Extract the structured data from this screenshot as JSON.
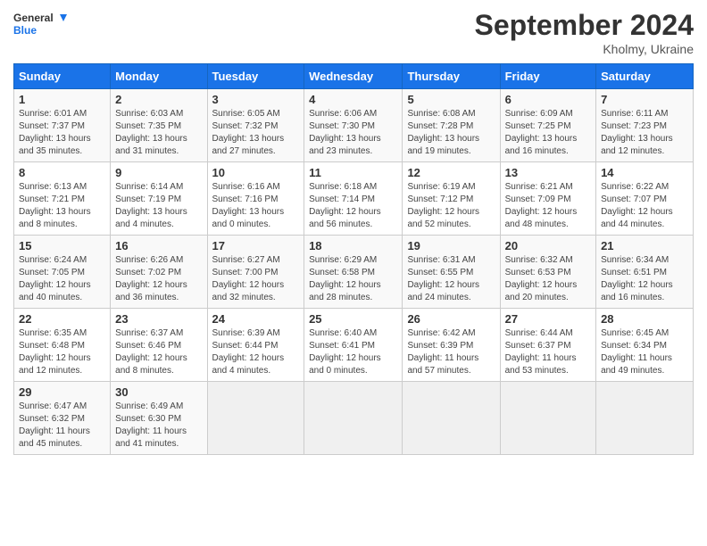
{
  "app": {
    "logo_line1": "General",
    "logo_line2": "Blue"
  },
  "header": {
    "month": "September 2024",
    "location": "Kholmy, Ukraine"
  },
  "days_of_week": [
    "Sunday",
    "Monday",
    "Tuesday",
    "Wednesday",
    "Thursday",
    "Friday",
    "Saturday"
  ],
  "weeks": [
    [
      {
        "day": "1",
        "info": "Sunrise: 6:01 AM\nSunset: 7:37 PM\nDaylight: 13 hours\nand 35 minutes."
      },
      {
        "day": "2",
        "info": "Sunrise: 6:03 AM\nSunset: 7:35 PM\nDaylight: 13 hours\nand 31 minutes."
      },
      {
        "day": "3",
        "info": "Sunrise: 6:05 AM\nSunset: 7:32 PM\nDaylight: 13 hours\nand 27 minutes."
      },
      {
        "day": "4",
        "info": "Sunrise: 6:06 AM\nSunset: 7:30 PM\nDaylight: 13 hours\nand 23 minutes."
      },
      {
        "day": "5",
        "info": "Sunrise: 6:08 AM\nSunset: 7:28 PM\nDaylight: 13 hours\nand 19 minutes."
      },
      {
        "day": "6",
        "info": "Sunrise: 6:09 AM\nSunset: 7:25 PM\nDaylight: 13 hours\nand 16 minutes."
      },
      {
        "day": "7",
        "info": "Sunrise: 6:11 AM\nSunset: 7:23 PM\nDaylight: 13 hours\nand 12 minutes."
      }
    ],
    [
      {
        "day": "8",
        "info": "Sunrise: 6:13 AM\nSunset: 7:21 PM\nDaylight: 13 hours\nand 8 minutes."
      },
      {
        "day": "9",
        "info": "Sunrise: 6:14 AM\nSunset: 7:19 PM\nDaylight: 13 hours\nand 4 minutes."
      },
      {
        "day": "10",
        "info": "Sunrise: 6:16 AM\nSunset: 7:16 PM\nDaylight: 13 hours\nand 0 minutes."
      },
      {
        "day": "11",
        "info": "Sunrise: 6:18 AM\nSunset: 7:14 PM\nDaylight: 12 hours\nand 56 minutes."
      },
      {
        "day": "12",
        "info": "Sunrise: 6:19 AM\nSunset: 7:12 PM\nDaylight: 12 hours\nand 52 minutes."
      },
      {
        "day": "13",
        "info": "Sunrise: 6:21 AM\nSunset: 7:09 PM\nDaylight: 12 hours\nand 48 minutes."
      },
      {
        "day": "14",
        "info": "Sunrise: 6:22 AM\nSunset: 7:07 PM\nDaylight: 12 hours\nand 44 minutes."
      }
    ],
    [
      {
        "day": "15",
        "info": "Sunrise: 6:24 AM\nSunset: 7:05 PM\nDaylight: 12 hours\nand 40 minutes."
      },
      {
        "day": "16",
        "info": "Sunrise: 6:26 AM\nSunset: 7:02 PM\nDaylight: 12 hours\nand 36 minutes."
      },
      {
        "day": "17",
        "info": "Sunrise: 6:27 AM\nSunset: 7:00 PM\nDaylight: 12 hours\nand 32 minutes."
      },
      {
        "day": "18",
        "info": "Sunrise: 6:29 AM\nSunset: 6:58 PM\nDaylight: 12 hours\nand 28 minutes."
      },
      {
        "day": "19",
        "info": "Sunrise: 6:31 AM\nSunset: 6:55 PM\nDaylight: 12 hours\nand 24 minutes."
      },
      {
        "day": "20",
        "info": "Sunrise: 6:32 AM\nSunset: 6:53 PM\nDaylight: 12 hours\nand 20 minutes."
      },
      {
        "day": "21",
        "info": "Sunrise: 6:34 AM\nSunset: 6:51 PM\nDaylight: 12 hours\nand 16 minutes."
      }
    ],
    [
      {
        "day": "22",
        "info": "Sunrise: 6:35 AM\nSunset: 6:48 PM\nDaylight: 12 hours\nand 12 minutes."
      },
      {
        "day": "23",
        "info": "Sunrise: 6:37 AM\nSunset: 6:46 PM\nDaylight: 12 hours\nand 8 minutes."
      },
      {
        "day": "24",
        "info": "Sunrise: 6:39 AM\nSunset: 6:44 PM\nDaylight: 12 hours\nand 4 minutes."
      },
      {
        "day": "25",
        "info": "Sunrise: 6:40 AM\nSunset: 6:41 PM\nDaylight: 12 hours\nand 0 minutes."
      },
      {
        "day": "26",
        "info": "Sunrise: 6:42 AM\nSunset: 6:39 PM\nDaylight: 11 hours\nand 57 minutes."
      },
      {
        "day": "27",
        "info": "Sunrise: 6:44 AM\nSunset: 6:37 PM\nDaylight: 11 hours\nand 53 minutes."
      },
      {
        "day": "28",
        "info": "Sunrise: 6:45 AM\nSunset: 6:34 PM\nDaylight: 11 hours\nand 49 minutes."
      }
    ],
    [
      {
        "day": "29",
        "info": "Sunrise: 6:47 AM\nSunset: 6:32 PM\nDaylight: 11 hours\nand 45 minutes."
      },
      {
        "day": "30",
        "info": "Sunrise: 6:49 AM\nSunset: 6:30 PM\nDaylight: 11 hours\nand 41 minutes."
      },
      {
        "day": "",
        "info": ""
      },
      {
        "day": "",
        "info": ""
      },
      {
        "day": "",
        "info": ""
      },
      {
        "day": "",
        "info": ""
      },
      {
        "day": "",
        "info": ""
      }
    ]
  ]
}
